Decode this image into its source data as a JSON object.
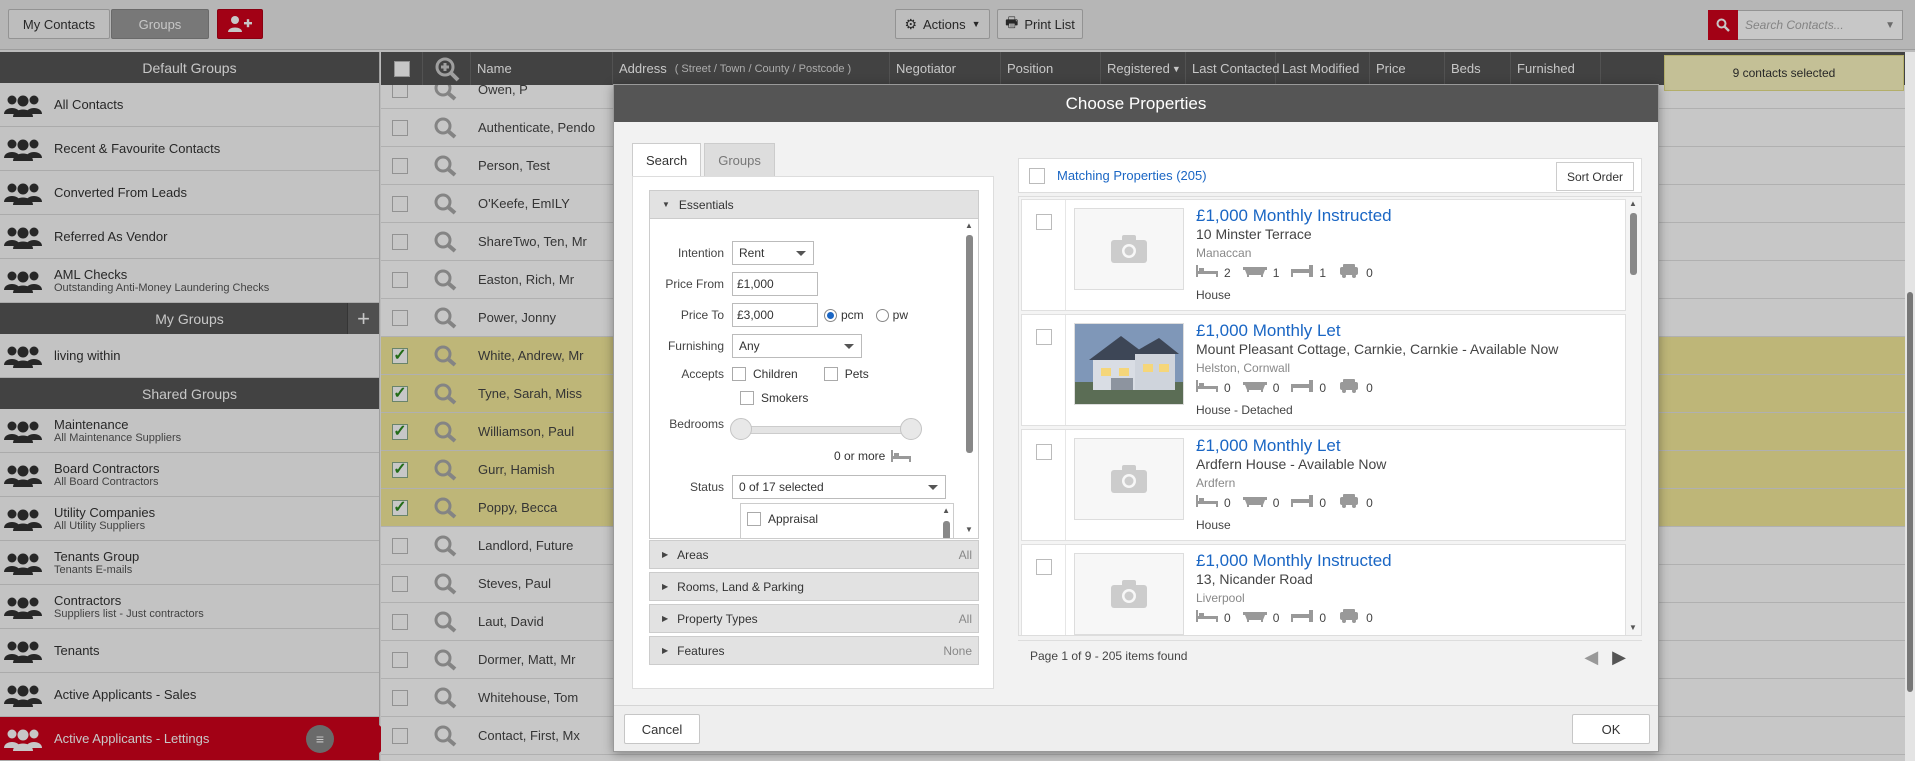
{
  "topbar": {
    "my_contacts": "My Contacts",
    "groups": "Groups",
    "actions": "Actions",
    "print_list": "Print List",
    "search_placeholder": "Search Contacts..."
  },
  "sidebar": {
    "default_head": "Default Groups",
    "default_items": [
      {
        "title": "All Contacts",
        "sub": ""
      },
      {
        "title": "Recent & Favourite Contacts",
        "sub": ""
      },
      {
        "title": "Converted From Leads",
        "sub": ""
      },
      {
        "title": "Referred As Vendor",
        "sub": ""
      },
      {
        "title": "AML Checks",
        "sub": "Outstanding Anti-Money Laundering Checks"
      }
    ],
    "my_head": "My Groups",
    "my_items": [
      {
        "title": "living within",
        "sub": ""
      }
    ],
    "shared_head": "Shared Groups",
    "shared_items": [
      {
        "title": "Maintenance",
        "sub": "All Maintenance Suppliers"
      },
      {
        "title": "Board Contractors",
        "sub": "All Board Contractors"
      },
      {
        "title": "Utility Companies",
        "sub": "All Utility Suppliers"
      },
      {
        "title": "Tenants Group",
        "sub": "Tenants E-mails"
      },
      {
        "title": "Contractors",
        "sub": "Suppliers list - Just contractors"
      },
      {
        "title": "Tenants",
        "sub": ""
      },
      {
        "title": "Active Applicants - Sales",
        "sub": ""
      },
      {
        "title": "Active Applicants - Lettings",
        "sub": ""
      }
    ]
  },
  "grid": {
    "headers": {
      "name": "Name",
      "address": "Address",
      "address_parts": "( Street /  Town /  County /  Postcode )",
      "negotiator": "Negotiator",
      "position": "Position",
      "registered": "Registered",
      "last_contacted": "Last Contacted",
      "last_modified": "Last Modified",
      "price": "Price",
      "beds": "Beds",
      "furnished": "Furnished"
    },
    "rows": [
      {
        "name": "Owen, P",
        "checked": false
      },
      {
        "name": "Authenticate, Pendo",
        "checked": false
      },
      {
        "name": "Person, Test",
        "checked": false
      },
      {
        "name": "O'Keefe, EmILY",
        "checked": false
      },
      {
        "name": "ShareTwo, Ten, Mr",
        "checked": false
      },
      {
        "name": "Easton, Rich, Mr",
        "checked": false
      },
      {
        "name": "Power, Jonny",
        "checked": false
      },
      {
        "name": "White, Andrew, Mr",
        "checked": true
      },
      {
        "name": "Tyne, Sarah, Miss",
        "checked": true
      },
      {
        "name": "Williamson, Paul",
        "checked": true
      },
      {
        "name": "Gurr, Hamish",
        "checked": true
      },
      {
        "name": "Poppy, Becca",
        "checked": true
      },
      {
        "name": "Landlord, Future",
        "checked": false
      },
      {
        "name": "Steves, Paul",
        "checked": false
      },
      {
        "name": "Laut, David",
        "checked": false
      },
      {
        "name": "Dormer, Matt, Mr",
        "checked": false
      },
      {
        "name": "Whitehouse, Tom",
        "checked": false
      },
      {
        "name": "Contact, First, Mx",
        "checked": false
      }
    ],
    "selected_badge": "9 contacts selected"
  },
  "modal": {
    "title": "Choose Properties",
    "tabs": [
      "Search",
      "Groups"
    ],
    "essentials": "Essentials",
    "labels": {
      "intention": "Intention",
      "price_from": "Price From",
      "price_to": "Price To",
      "furnishing": "Furnishing",
      "accepts": "Accepts",
      "bedrooms": "Bedrooms",
      "status": "Status"
    },
    "values": {
      "intention": "Rent",
      "price_from": "£1,000",
      "price_to": "£3,000",
      "pcm": "pcm",
      "pw": "pw",
      "furnishing": "Any",
      "children": "Children",
      "pets": "Pets",
      "smokers": "Smokers",
      "bedrooms_text": "0 or more",
      "status_sel": "0 of 17 selected",
      "status_opt": "Appraisal"
    },
    "sections": [
      {
        "name": "Areas",
        "value": "All"
      },
      {
        "name": "Rooms, Land & Parking",
        "value": ""
      },
      {
        "name": "Property Types",
        "value": "All"
      },
      {
        "name": "Features",
        "value": "None"
      }
    ],
    "results_title": "Matching Properties (205)",
    "sort_order": "Sort Order",
    "properties": [
      {
        "title": "£1,000 Monthly Instructed",
        "address": "10 Minster Terrace",
        "area": "Manaccan",
        "beds": "2",
        "baths": "1",
        "recep": "1",
        "parking": "0",
        "type": "House",
        "photo": false
      },
      {
        "title": "£1,000 Monthly Let",
        "address": "Mount Pleasant Cottage, Carnkie, Carnkie - Available Now",
        "area": "Helston, Cornwall",
        "beds": "0",
        "baths": "0",
        "recep": "0",
        "parking": "0",
        "type": "House - Detached",
        "photo": true
      },
      {
        "title": "£1,000 Monthly Let",
        "address": "Ardfern House - Available Now",
        "area": "Ardfern",
        "beds": "0",
        "baths": "0",
        "recep": "0",
        "parking": "0",
        "type": "House",
        "photo": false
      },
      {
        "title": "£1,000 Monthly Instructed",
        "address": "13, Nicander Road",
        "area": "Liverpool",
        "beds": "0",
        "baths": "0",
        "recep": "0",
        "parking": "0",
        "type": "",
        "photo": false
      }
    ],
    "page_info": "Page 1 of 9 - 205 items found",
    "cancel": "Cancel",
    "ok": "OK"
  }
}
